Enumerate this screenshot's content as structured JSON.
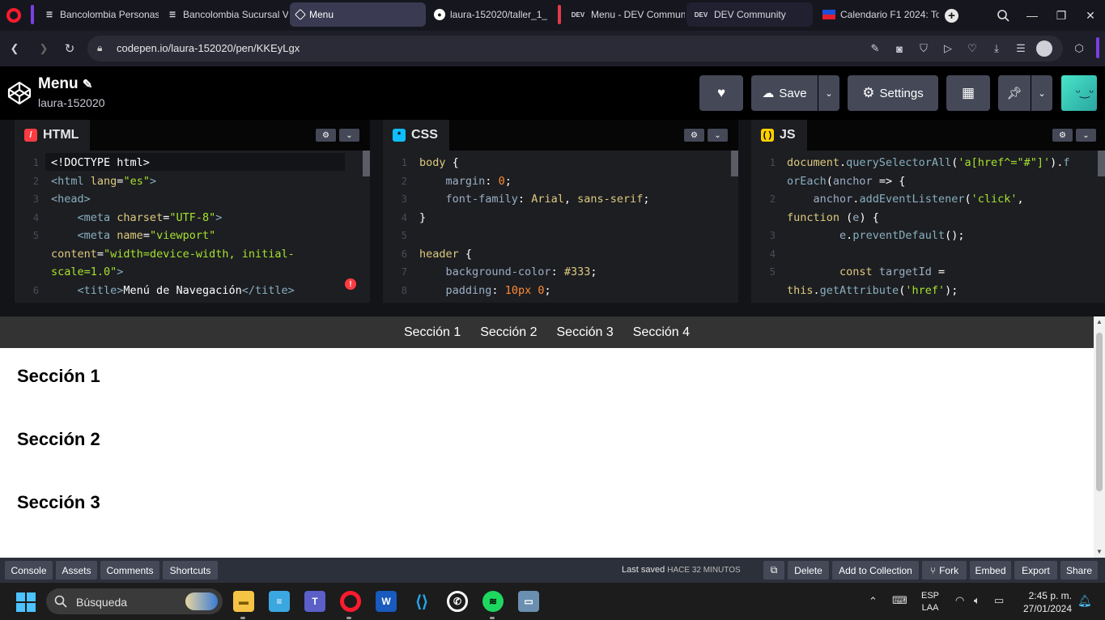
{
  "browser": {
    "tabs": [
      {
        "label": "Bancolombia Personas",
        "icon": "bancolombia-logo-icon"
      },
      {
        "label": "Bancolombia Sucursal V",
        "icon": "bancolombia-logo-icon"
      },
      {
        "label": "Menu",
        "icon": "codepen-logo-icon",
        "active": true
      },
      {
        "label": "laura-152020/taller_1_A",
        "icon": "github-logo-icon"
      },
      {
        "label": "Menu - DEV Communit",
        "icon": "dev-logo-icon"
      },
      {
        "label": "DEV Community",
        "icon": "dev-logo-icon"
      },
      {
        "label": "Calendario F1 2024: To",
        "icon": "flag-icon"
      }
    ],
    "new_tab": "+",
    "url": "codepen.io/laura-152020/pen/KKEyLgx"
  },
  "pen": {
    "title": "Menu",
    "author": "laura-152020",
    "buttons": {
      "save": "Save",
      "settings": "Settings"
    }
  },
  "editors": {
    "html": {
      "label": "HTML",
      "lines": [
        {
          "n": "1",
          "text": "<!DOCTYPE html>"
        },
        {
          "n": "2",
          "text": "<html lang=\"es\">"
        },
        {
          "n": "3",
          "text": "<head>"
        },
        {
          "n": "4",
          "text": "    <meta charset=\"UTF-8\">"
        },
        {
          "n": "5",
          "text": "    <meta name=\"viewport\""
        },
        {
          "n": "",
          "text": "content=\"width=device-width, initial-"
        },
        {
          "n": "",
          "text": "scale=1.0\">"
        },
        {
          "n": "6",
          "text": "    <title>Menú de Navegación</title>"
        }
      ]
    },
    "css": {
      "label": "CSS",
      "lines": [
        {
          "n": "1",
          "text": "body {"
        },
        {
          "n": "2",
          "text": "    margin: 0;"
        },
        {
          "n": "3",
          "text": "    font-family: Arial, sans-serif;"
        },
        {
          "n": "4",
          "text": "}"
        },
        {
          "n": "5",
          "text": ""
        },
        {
          "n": "6",
          "text": "header {"
        },
        {
          "n": "7",
          "text": "    background-color: #333;"
        },
        {
          "n": "8",
          "text": "    padding: 10px 0;"
        }
      ]
    },
    "js": {
      "label": "JS",
      "lines": [
        {
          "n": "1",
          "text": "document.querySelectorAll('a[href^=\"#\"]').f"
        },
        {
          "n": "",
          "text": "orEach(anchor => {"
        },
        {
          "n": "2",
          "text": "    anchor.addEventListener('click',"
        },
        {
          "n": "",
          "text": "function (e) {"
        },
        {
          "n": "3",
          "text": "        e.preventDefault();"
        },
        {
          "n": "4",
          "text": ""
        },
        {
          "n": "5",
          "text": "        const targetId ="
        },
        {
          "n": "",
          "text": "this.getAttribute('href');"
        }
      ]
    }
  },
  "preview": {
    "nav": [
      "Sección 1",
      "Sección 2",
      "Sección 3",
      "Sección 4"
    ],
    "sections": [
      "Sección 1",
      "Sección 2",
      "Sección 3"
    ]
  },
  "footer": {
    "left_buttons": [
      "Console",
      "Assets",
      "Comments",
      "Shortcuts"
    ],
    "last_saved_label": "Last saved",
    "last_saved_value": "HACE 32 MINUTOS",
    "right_buttons": [
      "Delete",
      "Add to Collection",
      "Fork",
      "Embed",
      "Export",
      "Share"
    ]
  },
  "taskbar": {
    "search_placeholder": "Búsqueda",
    "lang": "ESP",
    "lang_sub": "LAA",
    "time": "2:45 p. m.",
    "date": "27/01/2024"
  }
}
